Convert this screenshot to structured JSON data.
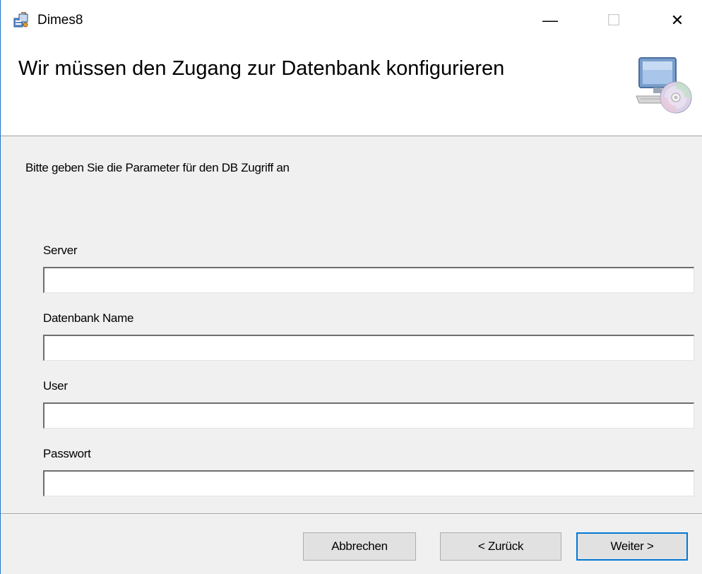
{
  "window": {
    "title": "Dimes8",
    "minimize_glyph": "—",
    "maximize_glyph": "☐",
    "close_glyph": "✕"
  },
  "banner": {
    "title": "Wir müssen den Zugang zur Datenbank konfigurieren",
    "graphic_icon": "computer-cd-icon"
  },
  "content": {
    "instruction": "Bitte geben Sie die Parameter für den DB Zugriff an",
    "fields": [
      {
        "label": "Server",
        "value": ""
      },
      {
        "label": "Datenbank Name",
        "value": ""
      },
      {
        "label": "User",
        "value": ""
      },
      {
        "label": "Passwort",
        "value": ""
      }
    ]
  },
  "footer": {
    "cancel_label": "Abbrechen",
    "back_label": "< Zurück",
    "next_label": "Weiter >"
  },
  "colors": {
    "accent": "#0078d7",
    "window_border": "#1e79c8",
    "dialog_bg": "#f0f0f0"
  }
}
